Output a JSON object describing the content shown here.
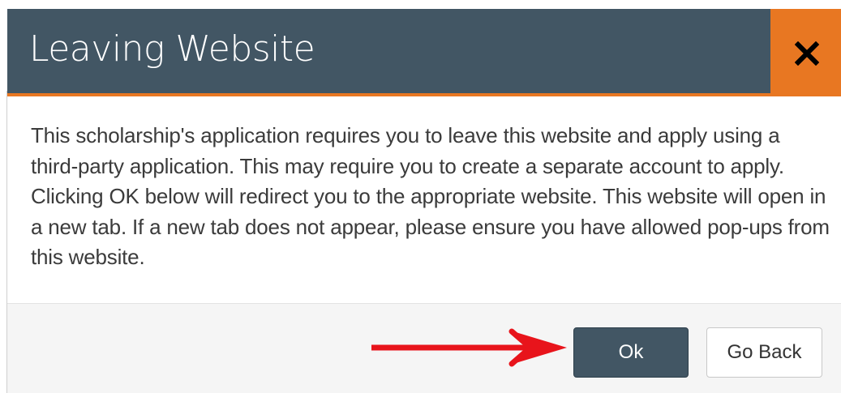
{
  "dialog": {
    "title": "Leaving Website",
    "close_icon": "close-x-icon",
    "message": "This scholarship's application requires you to leave this website and apply using a third-party application. This may require you to create a separate account to apply. Clicking OK below will redirect you to the appropriate website. This website will open in a new tab. If a new tab does not appear, please ensure you have allowed pop-ups from this website.",
    "buttons": {
      "ok_label": "Ok",
      "go_back_label": "Go Back"
    }
  },
  "annotation": {
    "arrow_icon": "red-arrow-icon",
    "arrow_color": "#e8141b"
  },
  "colors": {
    "header_bg": "#425664",
    "accent": "#e87722",
    "ok_button_bg": "#425664"
  }
}
